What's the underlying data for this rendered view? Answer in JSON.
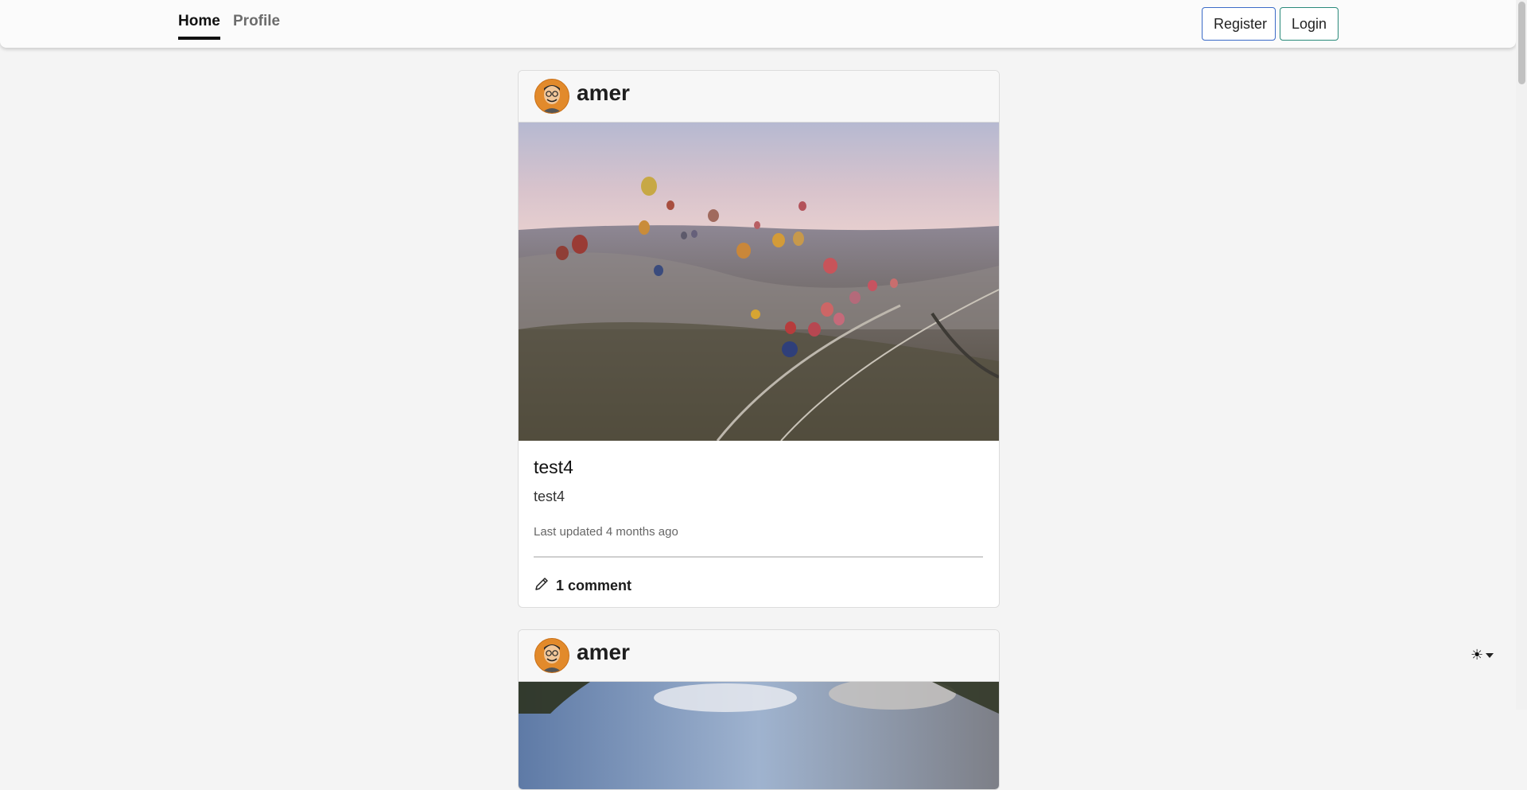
{
  "nav": {
    "home_label": "Home",
    "profile_label": "Profile",
    "register_label": "Register",
    "login_label": "Login"
  },
  "posts": [
    {
      "author": "amer",
      "title": "test4",
      "text": "test4",
      "updated": "Last updated 4 months ago",
      "comments": "1 comment",
      "image": "hot-air-balloons-over-valley"
    },
    {
      "author": "amer",
      "image": "trees-and-cloudy-sky"
    }
  ],
  "theme": {
    "icon": "sun-icon"
  },
  "colors": {
    "accent_register": "#3b6bc7",
    "accent_login": "#2a8a7a",
    "avatar": "#e28a2b"
  }
}
